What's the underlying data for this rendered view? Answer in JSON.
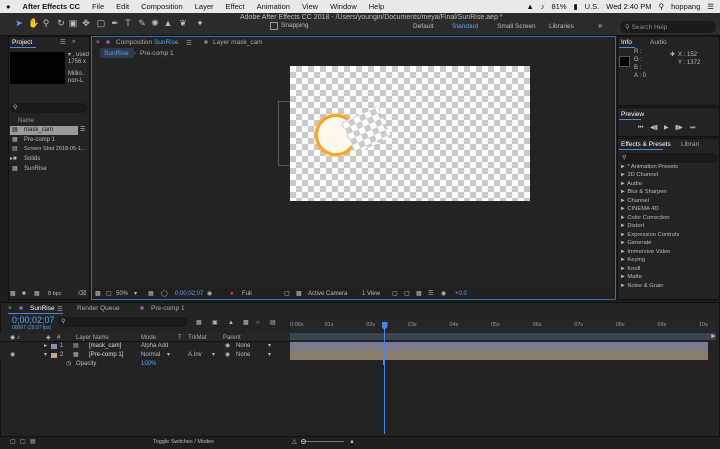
{
  "menubar": {
    "apple": "",
    "app_name": "After Effects CC",
    "items": [
      "File",
      "Edit",
      "Composition",
      "Layer",
      "Effect",
      "Animation",
      "View",
      "Window",
      "Help"
    ],
    "battery": "81%",
    "flag": "U.S.",
    "clock": "Wed 2:40 PM",
    "user": "hoppang"
  },
  "window_title": "Adobe After Effects CC 2018 - /Users/youngin/Documents/meya/Final/SunRise.aep *",
  "toolbar": {
    "snapping": "Snapping",
    "workspaces": [
      "Default",
      "Standard",
      "Small Screen",
      "Libraries"
    ],
    "active_workspace": "Standard",
    "search_placeholder": "Search Help"
  },
  "project_panel": {
    "tab": "Project",
    "thumb_text_1": "▾ , used",
    "thumb_text_2": "1756 x",
    "thumb_text_3": "Millio..",
    "thumb_text_4": "non-L",
    "column_name": "Name",
    "items": [
      "mask_cam",
      "Pre-comp 1",
      "Screen Shot 2018-05-1…",
      "Solids",
      "SunRise"
    ],
    "bpc": "8 bpc"
  },
  "composition_panel": {
    "tab_label": "Composition",
    "tab_comp": "SunRise",
    "layer_tab": "Layer mask_cam",
    "breadcrumb": [
      "SunRise",
      "Pre-comp 1"
    ],
    "zoom": "50%",
    "timecode": "0;00;02;07",
    "resolution": "Full",
    "camera": "Active Camera",
    "view": "1 View",
    "exposure": "+0.0"
  },
  "info_panel": {
    "tabs": [
      "Info",
      "Audio"
    ],
    "r": "R :",
    "g": "G :",
    "b": "B :",
    "a": "A :  0",
    "x": "X : 152",
    "y": "Y : 1372"
  },
  "preview_panel": {
    "tab": "Preview"
  },
  "effects_panel": {
    "tabs": [
      "Effects & Presets",
      "Librari"
    ],
    "items": [
      "► * Animation Presets",
      "► 3D Channel",
      "► Audio",
      "► Blur & Sharpen",
      "► Channel",
      "► CINEMA 4D",
      "► Color Correction",
      "► Distort",
      "► Expression Controls",
      "► Generate",
      "► Immersive Video",
      "► Keying",
      "► Knoll",
      "► Matte",
      "► Noise & Grain"
    ]
  },
  "timeline": {
    "tabs": [
      "SunRise",
      "Render Queue",
      "Pre-comp 1"
    ],
    "timecode": "0;00;02;07",
    "fps": "00067 (29.97 fps)",
    "col_layer_name": "Layer Name",
    "col_mode": "Mode",
    "col_t": "T",
    "col_trkmat": "TrkMat",
    "col_parent": "Parent",
    "layers": [
      {
        "num": "1",
        "name": "[mask_cam]",
        "mode": "Alpha Add",
        "trkmat": "",
        "parent": "None"
      },
      {
        "num": "2",
        "name": "[Pre-comp 1]",
        "mode": "Normal",
        "trkmat": "A.Inv",
        "parent": "None"
      }
    ],
    "property": "Opacity",
    "property_value": "100%",
    "ruler": [
      "0:00s",
      "01s",
      "02s",
      "03s",
      "04s",
      "05s",
      "06s",
      "07s",
      "08s",
      "09s",
      "10s"
    ],
    "toggle": "Toggle Switches / Modes",
    "playhead_fraction": 0.22
  },
  "colors": {
    "accent": "#4a86e8",
    "layer1_bar": "#7a7c8c",
    "layer2_bar": "#8a806a",
    "sun": "#f5a623"
  }
}
